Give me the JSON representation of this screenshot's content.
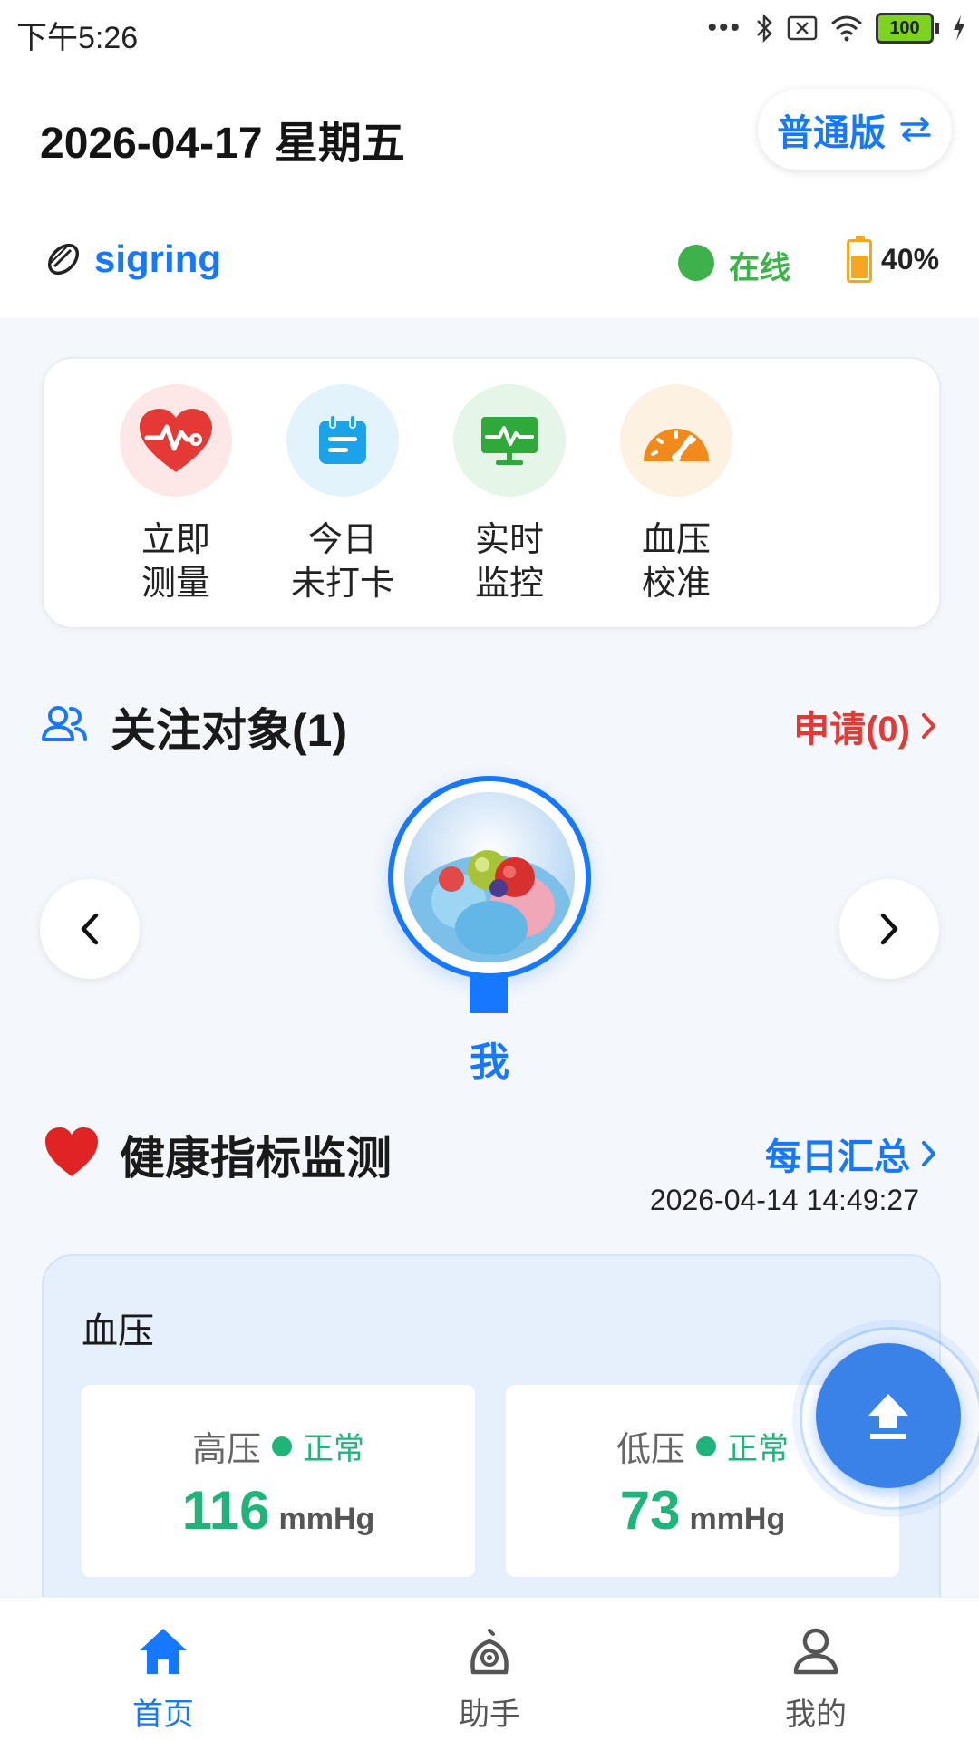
{
  "statusbar": {
    "time": "下午5:26",
    "battery": "100"
  },
  "header": {
    "date": "2026-04-17 星期五",
    "edition_label": "普通版",
    "device_name": "sigring",
    "online_status": "在线",
    "battery_percent": "40%"
  },
  "quick_actions": [
    {
      "label": "立即\n测量",
      "icon": "heart-pulse-icon",
      "color": "#e53935",
      "bg": "#fde7e7"
    },
    {
      "label": "今日\n未打卡",
      "icon": "calendar-icon",
      "color": "#1aa3e8",
      "bg": "#e3f3fc"
    },
    {
      "label": "实时\n监控",
      "icon": "monitor-pulse-icon",
      "color": "#2faa3a",
      "bg": "#e5f5e8"
    },
    {
      "label": "血压\n校准",
      "icon": "gauge-icon",
      "color": "#f28a1b",
      "bg": "#fdf2e1"
    }
  ],
  "follow": {
    "title": "关注对象(1)",
    "apply_label": "申请(0)",
    "current_person": "我"
  },
  "health": {
    "title": "健康指标监测",
    "daily_summary_label": "每日汇总",
    "timestamp": "2026-04-14 14:49:27",
    "bp_card_title": "血压",
    "systolic": {
      "name": "高压",
      "status": "正常",
      "value": "116",
      "unit": "mmHg"
    },
    "diastolic": {
      "name": "低压",
      "status": "正常",
      "value": "73",
      "unit": "mmHg"
    }
  },
  "tabbar": [
    {
      "label": "首页",
      "icon": "home-icon",
      "active": true
    },
    {
      "label": "助手",
      "icon": "assistant-icon",
      "active": false
    },
    {
      "label": "我的",
      "icon": "profile-icon",
      "active": false
    }
  ],
  "colors": {
    "primary": "#1677ff",
    "danger": "#e53935",
    "success": "#1fb47a",
    "online": "#3db24b"
  }
}
